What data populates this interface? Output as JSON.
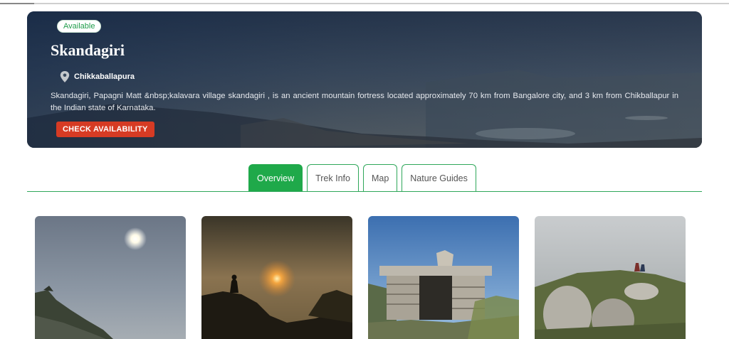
{
  "hero": {
    "badge": "Available",
    "title": "Skandagiri",
    "location": "Chikkaballapura",
    "description": "Skandagiri, Papagni Matt &nbsp;kalavara village skandagiri , is an ancient mountain fortress located approximately 70 km from Bangalore city, and 3 km from Chikballapur in the Indian state of Karnataka.",
    "cta": "CHECK AVAILABILITY"
  },
  "tabs": [
    {
      "label": "Overview",
      "active": true
    },
    {
      "label": "Trek Info",
      "active": false
    },
    {
      "label": "Map",
      "active": false
    },
    {
      "label": "Nature Guides",
      "active": false
    }
  ],
  "gallery": [
    {
      "subject": "moon over hazy hills"
    },
    {
      "subject": "sunrise silhouette"
    },
    {
      "subject": "stone temple ruin"
    },
    {
      "subject": "hikers on rocky summit"
    }
  ],
  "colors": {
    "accent_green": "#1fa94a",
    "cta_red": "#d63b24",
    "badge_text": "#1f9d4a"
  },
  "icons": {
    "location": "map-pin-icon"
  }
}
